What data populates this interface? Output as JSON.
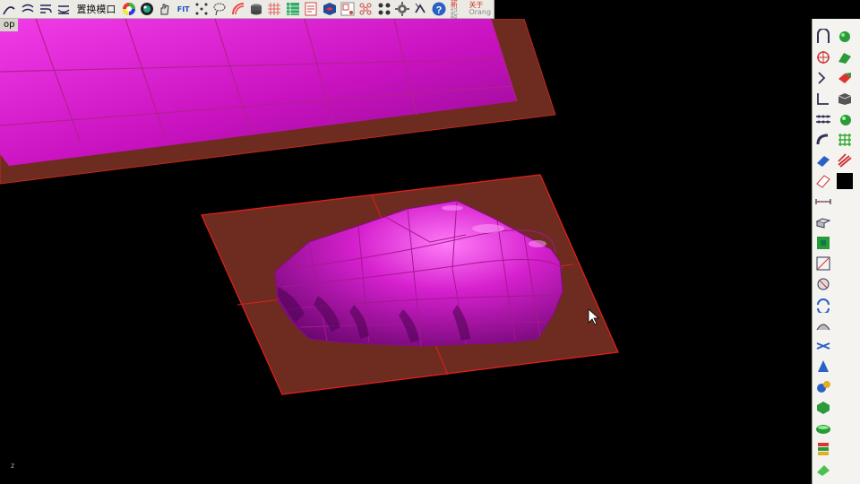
{
  "toolbar": {
    "items": [
      {
        "type": "icon",
        "name": "curve-edit-icon"
      },
      {
        "type": "icon",
        "name": "offset-curve-icon"
      },
      {
        "type": "icon",
        "name": "blend-curve-icon"
      },
      {
        "type": "icon",
        "name": "match-curve-icon"
      },
      {
        "type": "text",
        "name": "replace-mode-label",
        "label": "置换模口"
      },
      {
        "type": "icon",
        "name": "color-wheel-icon"
      },
      {
        "type": "icon",
        "name": "render-sphere-icon"
      },
      {
        "type": "icon",
        "name": "hand-icon"
      },
      {
        "type": "icon",
        "name": "fit-view-icon",
        "label": "FIT"
      },
      {
        "type": "icon",
        "name": "select-points-icon"
      },
      {
        "type": "icon",
        "name": "lasso-icon"
      },
      {
        "type": "icon",
        "name": "arc-icon"
      },
      {
        "type": "icon",
        "name": "cylinder-icon"
      },
      {
        "type": "icon",
        "name": "mesh-grid-icon"
      },
      {
        "type": "icon",
        "name": "layer-panel-icon"
      },
      {
        "type": "icon",
        "name": "properties-icon"
      },
      {
        "type": "icon",
        "name": "cube-icon"
      },
      {
        "type": "icon",
        "name": "snap-icon"
      },
      {
        "type": "icon",
        "name": "pattern-icon"
      },
      {
        "type": "icon",
        "name": "dots-icon"
      },
      {
        "type": "icon",
        "name": "gear-icon"
      },
      {
        "type": "icon",
        "name": "transform-icon"
      },
      {
        "type": "icon",
        "name": "help-icon"
      }
    ],
    "update_text": {
      "line1": "更新",
      "line2": "記錄"
    },
    "about_text": {
      "line1": "关于",
      "line2": "Orang"
    }
  },
  "viewport": {
    "label": "op",
    "axis_label": "z"
  },
  "right_panel": {
    "buttons": [
      "rail-icon",
      "sweep-icon",
      "point-icon",
      "loft-icon",
      "extend-icon",
      "patch-icon",
      "blend-icon",
      "box-icon",
      "array-icon",
      "sphere-icon",
      "pipe-icon",
      "grid-icon",
      "plane-icon",
      "rib-icon",
      "surface-icon",
      "color-swatch",
      "dimension-icon",
      "extrude-icon",
      "green-box-icon",
      "edit-points-icon",
      "move-icon",
      "revolve-icon",
      "bend-icon",
      "twist-icon",
      "cone-icon",
      "spheres-icon",
      "hexagon-icon",
      "ellipse-icon",
      "stack-icon",
      "paint-icon"
    ]
  },
  "colors": {
    "plate": "#6e2b1f",
    "plate_edge": "#e0201a",
    "surface": "#d81ad0",
    "surface_light": "#ff6cf5",
    "surface_dark": "#5a0660",
    "background": "#000000"
  }
}
